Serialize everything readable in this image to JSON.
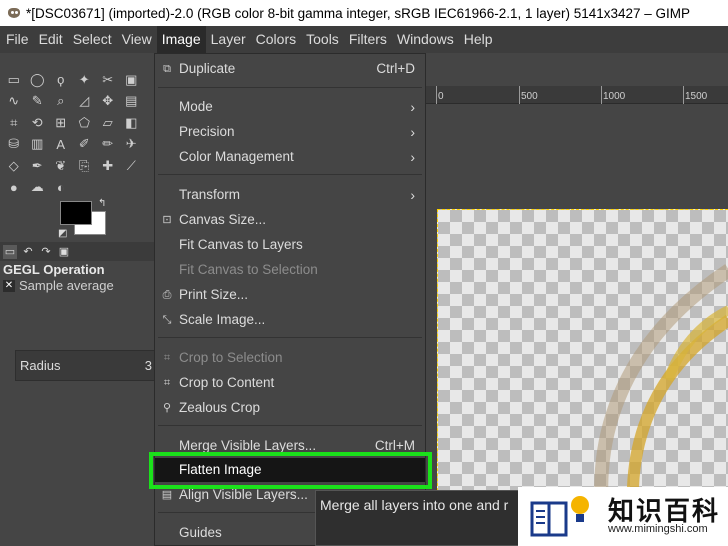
{
  "window": {
    "title": "*[DSC03671] (imported)-2.0 (RGB color 8-bit gamma integer, sRGB IEC61966-2.1, 1 layer) 5141x3427 – GIMP"
  },
  "menubar": {
    "items": [
      "File",
      "Edit",
      "Select",
      "View",
      "Image",
      "Layer",
      "Colors",
      "Tools",
      "Filters",
      "Windows",
      "Help"
    ],
    "active": "Image"
  },
  "tool_options": {
    "title": "GEGL Operation",
    "sample": "Sample average",
    "radius_label": "Radius",
    "radius_value": "3"
  },
  "ruler": {
    "labels": [
      "0",
      "500",
      "1000",
      "1500"
    ]
  },
  "image_menu": {
    "items": [
      {
        "label": "Duplicate",
        "shortcut": "Ctrl+D",
        "icon": "duplicate-icon",
        "enabled": true
      },
      {
        "label": "Mode",
        "submenu": true,
        "enabled": true
      },
      {
        "label": "Precision",
        "submenu": true,
        "enabled": true
      },
      {
        "label": "Color Management",
        "submenu": true,
        "enabled": true
      },
      {
        "label": "Transform",
        "submenu": true,
        "enabled": true
      },
      {
        "label": "Canvas Size...",
        "icon": "canvas-size-icon",
        "enabled": true
      },
      {
        "label": "Fit Canvas to Layers",
        "enabled": true
      },
      {
        "label": "Fit Canvas to Selection",
        "enabled": false
      },
      {
        "label": "Print Size...",
        "icon": "print-icon",
        "enabled": true
      },
      {
        "label": "Scale Image...",
        "icon": "scale-icon",
        "enabled": true
      },
      {
        "label": "Crop to Selection",
        "icon": "crop-icon",
        "enabled": false
      },
      {
        "label": "Crop to Content",
        "icon": "crop-icon",
        "enabled": true
      },
      {
        "label": "Zealous Crop",
        "icon": "zealous-crop-icon",
        "enabled": true
      },
      {
        "label": "Merge Visible Layers...",
        "shortcut": "Ctrl+M",
        "enabled": true
      },
      {
        "label": "Flatten Image",
        "enabled": true,
        "highlighted": true
      },
      {
        "label": "Align Visible Layers...",
        "icon": "align-icon",
        "enabled": true
      },
      {
        "label": "Guides",
        "enabled": true
      }
    ]
  },
  "tooltip": {
    "text": "Merge all layers into one and r"
  },
  "watermark": {
    "title": "知识百科",
    "url": "www.mimingshi.com"
  },
  "colors": {
    "highlight_box": "#1be11b",
    "foreground": "#000000",
    "background": "#ffffff"
  }
}
